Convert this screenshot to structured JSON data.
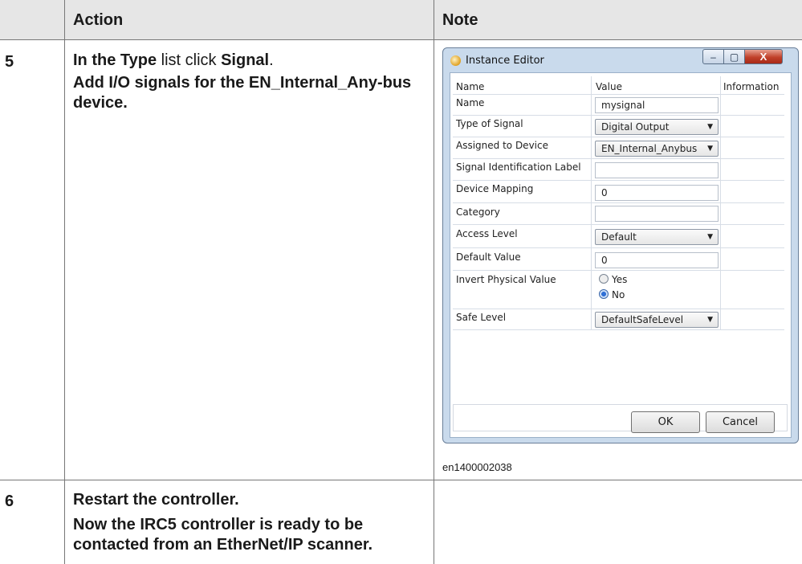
{
  "table": {
    "header": {
      "col_step": "",
      "col_action": "Action",
      "col_note": "Note"
    },
    "rows": [
      {
        "step": "5",
        "action_line1_prefix": "In the ",
        "action_line1_b1": "Type",
        "action_line1_mid": " list click ",
        "action_line1_b2": "Signal",
        "action_line1_suffix": ".",
        "action_line2": "Add I/O signals for the EN_Internal_Any-bus device.",
        "figure_id": "en1400002038"
      },
      {
        "step": "6",
        "action_line1": "Restart the controller.",
        "action_line2": "Now the IRC5 controller is ready to be contacted from an EtherNet/IP scanner."
      }
    ]
  },
  "dialog": {
    "title": "Instance Editor",
    "controls": {
      "minimize": "–",
      "maximize": "▢",
      "close": "X"
    },
    "columns": {
      "name": "Name",
      "value": "Value",
      "information": "Information"
    },
    "rows": [
      {
        "name": "Name",
        "value": "mysignal",
        "kind": "text"
      },
      {
        "name": "Type of Signal",
        "value": "Digital Output",
        "kind": "combo"
      },
      {
        "name": "Assigned to Device",
        "value": "EN_Internal_Anybus",
        "kind": "combo"
      },
      {
        "name": "Signal Identification Label",
        "value": "",
        "kind": "text"
      },
      {
        "name": "Device Mapping",
        "value": "0",
        "kind": "text"
      },
      {
        "name": "Category",
        "value": "",
        "kind": "text"
      },
      {
        "name": "Access Level",
        "value": "Default",
        "kind": "combo"
      },
      {
        "name": "Default Value",
        "value": "0",
        "kind": "text"
      },
      {
        "name": "Invert Physical Value",
        "kind": "radio",
        "options": [
          "Yes",
          "No"
        ],
        "selected": "No"
      },
      {
        "name": "Safe Level",
        "value": "DefaultSafeLevel",
        "kind": "combo"
      }
    ],
    "buttons": {
      "ok": "OK",
      "cancel": "Cancel"
    }
  }
}
